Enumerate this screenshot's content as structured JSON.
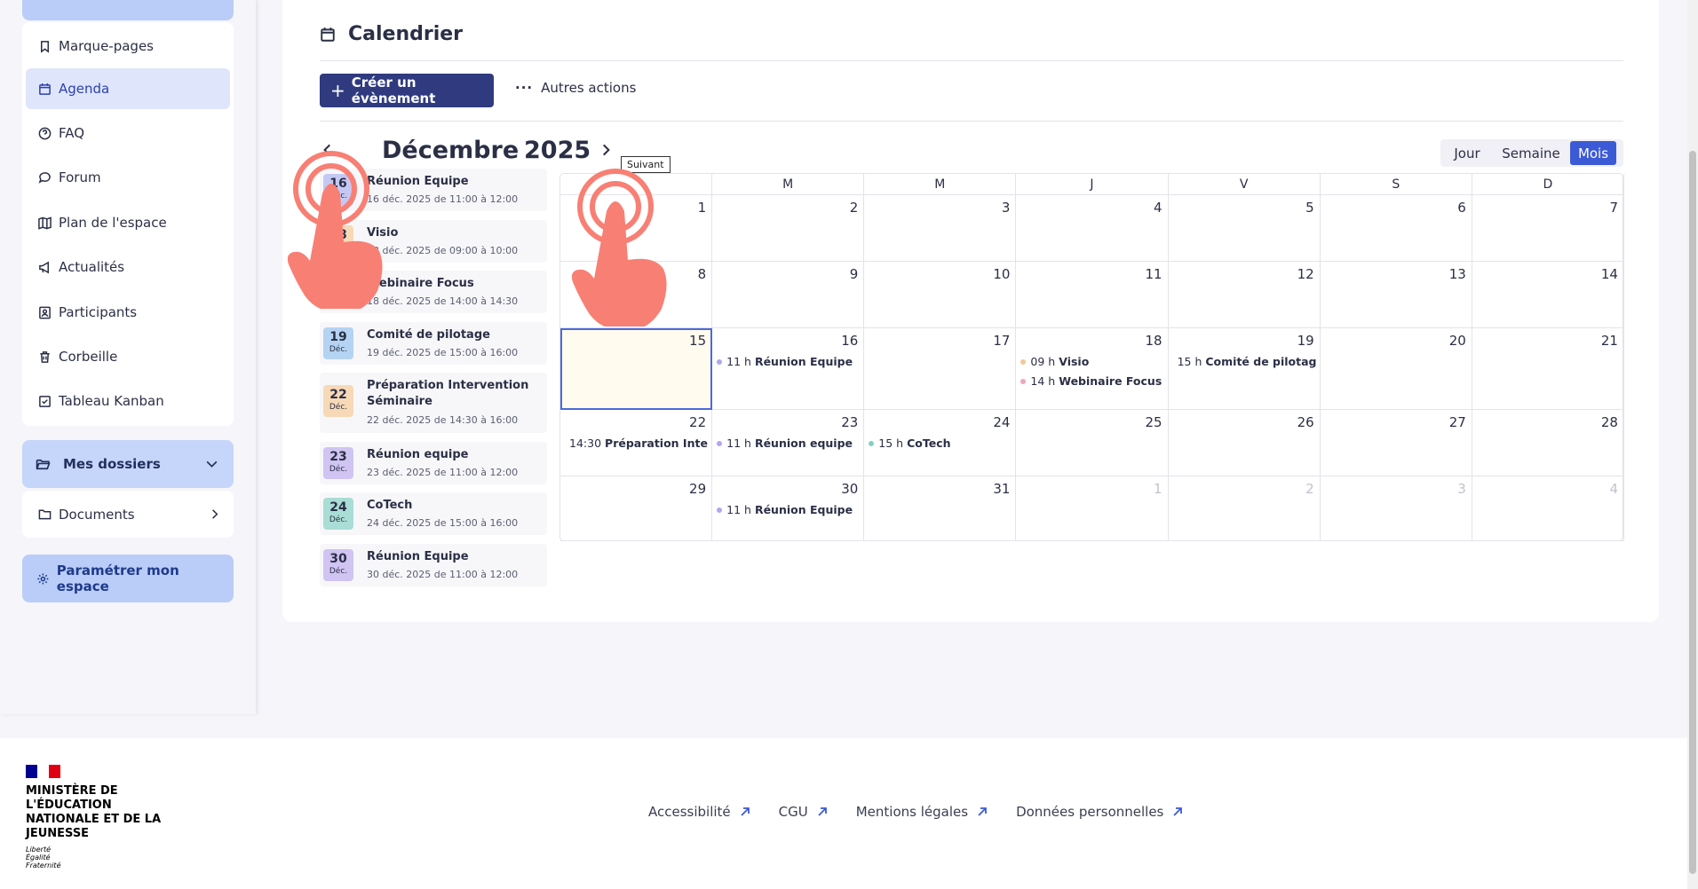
{
  "sidebar": {
    "items": [
      {
        "label": "Marque-pages",
        "icon": "bookmark-icon"
      },
      {
        "label": "Agenda",
        "icon": "calendar-icon"
      },
      {
        "label": "FAQ",
        "icon": "help-icon"
      },
      {
        "label": "Forum",
        "icon": "forum-icon"
      },
      {
        "label": "Plan de l'espace",
        "icon": "map-icon"
      },
      {
        "label": "Actualités",
        "icon": "megaphone-icon"
      },
      {
        "label": "Participants",
        "icon": "participants-icon"
      },
      {
        "label": "Corbeille",
        "icon": "trash-icon"
      },
      {
        "label": "Tableau Kanban",
        "icon": "kanban-icon"
      }
    ],
    "active_index": 1,
    "folders_label": "Mes dossiers",
    "documents_label": "Documents",
    "settings_label": "Paramétrer mon espace"
  },
  "main": {
    "title": "Calendrier",
    "create_label": "Créer un évènement",
    "more_label": "Autres actions",
    "month": "Décembre",
    "year": "2025",
    "tooltip": "Suivant",
    "views": {
      "day": "Jour",
      "week": "Semaine",
      "month": "Mois",
      "selected": "month"
    }
  },
  "events": [
    {
      "day": "16",
      "month": "Déc.",
      "title": "Réunion Equipe",
      "when": "16 déc. 2025 de 11:00 à 12:00",
      "color": "#c4c8f3"
    },
    {
      "day": "18",
      "month": "Déc.",
      "title": "Visio",
      "when": "18 déc. 2025 de 09:00 à 10:00",
      "color": "#f7d9b7"
    },
    {
      "day": "18",
      "month": "Déc.",
      "title": "Webinaire Focus",
      "when": "18 déc. 2025 de 14:00 à 14:30",
      "color": "#f4c6d4"
    },
    {
      "day": "19",
      "month": "Déc.",
      "title": "Comité de pilotage",
      "when": "19 déc. 2025 de 15:00 à 16:00",
      "color": "#b5d3f2"
    },
    {
      "day": "22",
      "month": "Déc.",
      "title": "Préparation Intervention Séminaire",
      "when": "22 déc. 2025 de 14:30 à 16:00",
      "color": "#f7d9b7"
    },
    {
      "day": "23",
      "month": "Déc.",
      "title": "Réunion equipe",
      "when": "23 déc. 2025 de 11:00 à 12:00",
      "color": "#d0c4f2"
    },
    {
      "day": "24",
      "month": "Déc.",
      "title": "CoTech",
      "when": "24 déc. 2025 de 15:00 à 16:00",
      "color": "#a9ddd6"
    },
    {
      "day": "30",
      "month": "Déc.",
      "title": "Réunion Equipe",
      "when": "30 déc. 2025 de 11:00 à 12:00",
      "color": "#d0c4f2"
    }
  ],
  "calendar": {
    "weekdays": [
      "",
      "M",
      "M",
      "J",
      "V",
      "S",
      "D"
    ],
    "weeks": [
      [
        {
          "n": "1"
        },
        {
          "n": "2"
        },
        {
          "n": "3"
        },
        {
          "n": "4"
        },
        {
          "n": "5"
        },
        {
          "n": "6"
        },
        {
          "n": "7"
        }
      ],
      [
        {
          "n": "8"
        },
        {
          "n": "9"
        },
        {
          "n": "10"
        },
        {
          "n": "11"
        },
        {
          "n": "12"
        },
        {
          "n": "13"
        },
        {
          "n": "14"
        }
      ],
      [
        {
          "n": "15",
          "today": true
        },
        {
          "n": "16",
          "events": [
            {
              "time": "11 h",
              "title": "Réunion Equipe",
              "color": "#a9a9ef"
            }
          ]
        },
        {
          "n": "17"
        },
        {
          "n": "18",
          "events": [
            {
              "time": "09 h",
              "title": "Visio",
              "color": "#f0c79a"
            },
            {
              "time": "14 h",
              "title": "Webinaire Focus",
              "color": "#f1a5bd"
            }
          ]
        },
        {
          "n": "19",
          "events": [
            {
              "time": "15 h",
              "title": "Comité de pilotage",
              "color": "#90bdf0"
            }
          ]
        },
        {
          "n": "20"
        },
        {
          "n": "21"
        }
      ],
      [
        {
          "n": "22",
          "events": [
            {
              "time": "14:30",
              "title": "Préparation Intervention Séminaire",
              "color": "#f0c79a"
            }
          ]
        },
        {
          "n": "23",
          "events": [
            {
              "time": "11 h",
              "title": "Réunion equipe",
              "color": "#b4a5ef"
            }
          ]
        },
        {
          "n": "24",
          "events": [
            {
              "time": "15 h",
              "title": "CoTech",
              "color": "#85cfc4"
            }
          ]
        },
        {
          "n": "25"
        },
        {
          "n": "26"
        },
        {
          "n": "27"
        },
        {
          "n": "28"
        }
      ],
      [
        {
          "n": "29"
        },
        {
          "n": "30",
          "events": [
            {
              "time": "11 h",
              "title": "Réunion Equipe",
              "color": "#b4a5ef"
            }
          ]
        },
        {
          "n": "31"
        },
        {
          "n": "1",
          "other": true
        },
        {
          "n": "2",
          "other": true
        },
        {
          "n": "3",
          "other": true
        },
        {
          "n": "4",
          "other": true
        }
      ]
    ]
  },
  "footer": {
    "ministry": "MINISTÈRE DE L'ÉDUCATION NATIONALE ET DE LA JEUNESSE",
    "motto": "Liberté Égalité Fraternité",
    "links": [
      "Accessibilité",
      "CGU",
      "Mentions légales",
      "Données personnelles"
    ]
  },
  "colors": {
    "primary": "#2f3b7e",
    "accent": "#3d5ad6",
    "touch": "#f87f74"
  }
}
